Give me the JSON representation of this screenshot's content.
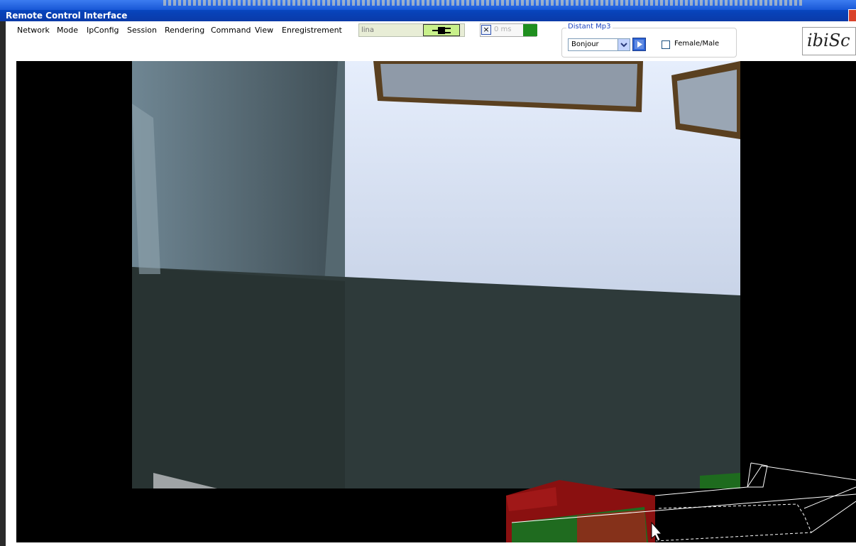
{
  "window": {
    "title": "Remote Control Interface"
  },
  "menu": {
    "items": [
      "Network",
      "Mode",
      "IpConfig",
      "Session",
      "Rendering",
      "Command",
      "View",
      "Enregistrement"
    ]
  },
  "connection": {
    "host_placeholder": "lina",
    "latency": "0 ms"
  },
  "mp3": {
    "group_label": "Distant Mp3",
    "selected": "Bonjour",
    "gender_label": "Female/Male"
  },
  "logo": {
    "text": "ibiSc"
  },
  "colors": {
    "titlebar": "#0842b8",
    "connect_button": "#c8f08a",
    "latency_ok": "#1f8f1f",
    "robot_body": "#8a1010"
  }
}
